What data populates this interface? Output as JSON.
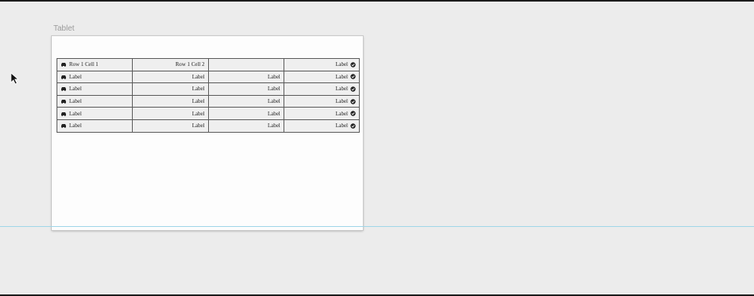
{
  "canvas": {
    "artboard_name": "Tablet"
  },
  "table": {
    "rows": [
      {
        "c1": "Row 1 Cell 1",
        "c2": "Row 1 Cell 2",
        "c3": "",
        "c4": "Label"
      },
      {
        "c1": "Label",
        "c2": "Label",
        "c3": "Label",
        "c4": "Label"
      },
      {
        "c1": "Label",
        "c2": "Label",
        "c3": "Label",
        "c4": "Label"
      },
      {
        "c1": "Label",
        "c2": "Label",
        "c3": "Label",
        "c4": "Label"
      },
      {
        "c1": "Label",
        "c2": "Label",
        "c3": "Label",
        "c4": "Label"
      },
      {
        "c1": "Label",
        "c2": "Label",
        "c3": "Label",
        "c4": "Label"
      }
    ]
  },
  "icons": {
    "row_leading": "car-icon",
    "row_trailing": "check-circle-icon",
    "pointer": "cursor-arrow-icon"
  },
  "colors": {
    "canvas_bg": "#ececec",
    "artboard_bg": "#fdfdfd",
    "guide": "#9fd6e8",
    "cell_bg": "#efefef"
  }
}
